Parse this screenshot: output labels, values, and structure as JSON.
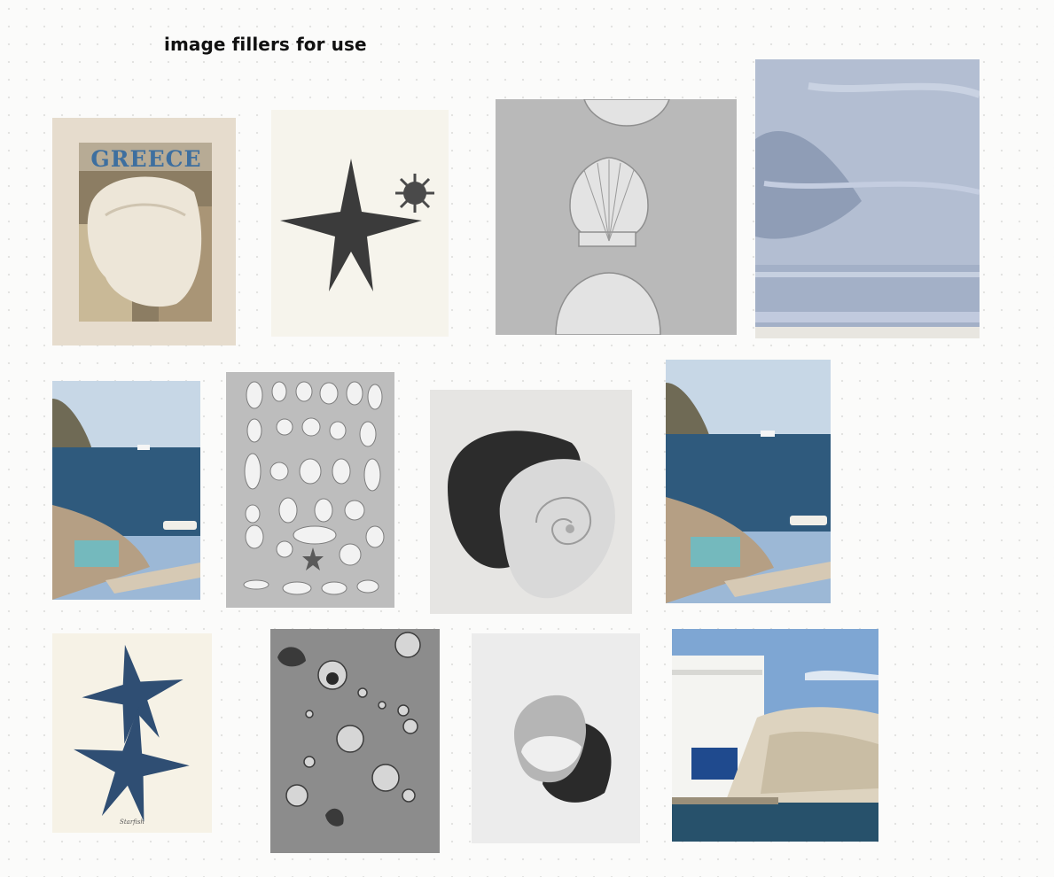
{
  "page": {
    "title": "image fillers for use"
  },
  "images": {
    "greece_book": {
      "cover_text": "GREECE"
    },
    "starfish_print": {
      "signature": "Starfish"
    }
  },
  "icons": [
    "starfish-icon",
    "scallop-shell-icon",
    "nautilus-shell-icon",
    "conch-shell-icon",
    "snail-shell-icon"
  ],
  "colors": {
    "background": "#fbfbfa",
    "dots": "#e3e3e1",
    "accent_blue": "#3e6f9f"
  }
}
